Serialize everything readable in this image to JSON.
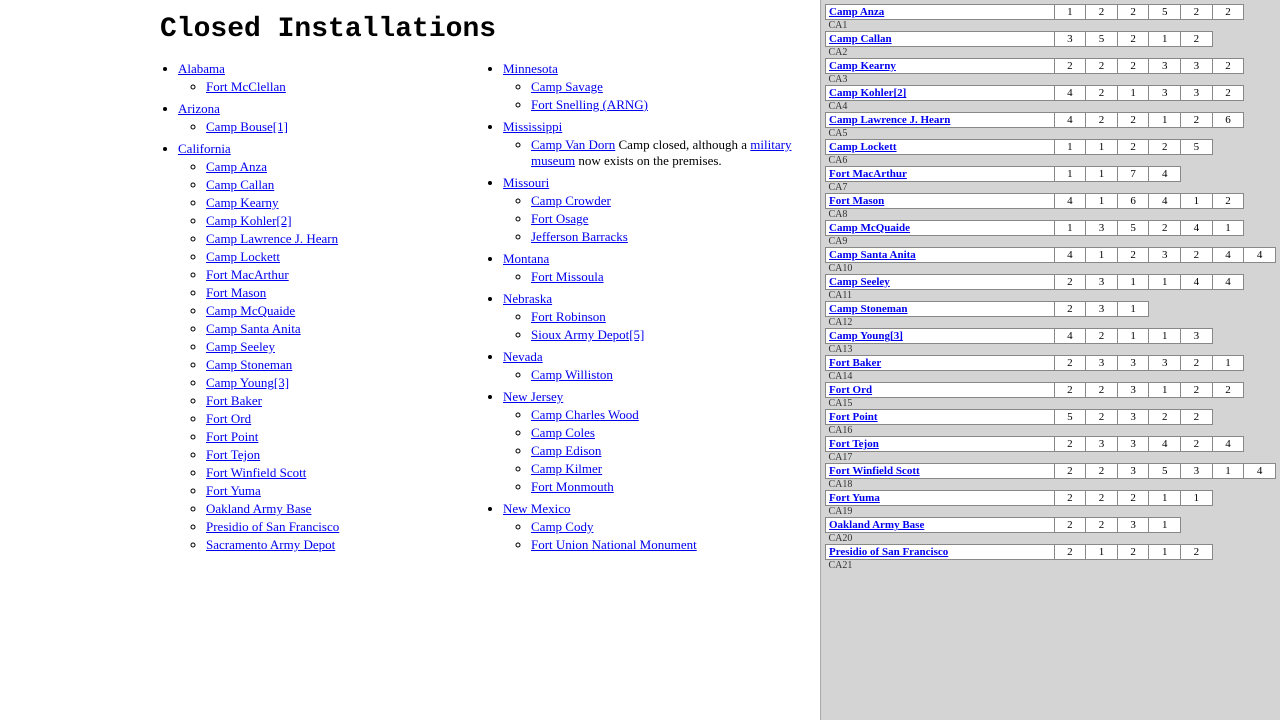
{
  "page": {
    "title": "Closed Installations"
  },
  "left_column": {
    "states": [
      {
        "name": "Alabama",
        "installations": [
          {
            "name": "Fort McClellan",
            "sub": false
          }
        ]
      },
      {
        "name": "Arizona",
        "installations": [
          {
            "name": "Camp Bouse[1]",
            "sub": false
          }
        ]
      },
      {
        "name": "California",
        "installations": [
          {
            "name": "Camp Anza",
            "sub": false
          },
          {
            "name": "Camp Callan",
            "sub": false
          },
          {
            "name": "Camp Kearny",
            "sub": false
          },
          {
            "name": "Camp Kohler[2]",
            "sub": false
          },
          {
            "name": "Camp Lawrence J. Hearn",
            "sub": false
          },
          {
            "name": "Camp Lockett",
            "sub": false
          },
          {
            "name": "Fort MacArthur",
            "sub": false
          },
          {
            "name": "Fort Mason",
            "sub": false
          },
          {
            "name": "Camp McQuaide",
            "sub": false
          },
          {
            "name": "Camp Santa Anita",
            "sub": false
          },
          {
            "name": "Camp Seeley",
            "sub": false
          },
          {
            "name": "Camp Stoneman",
            "sub": false
          },
          {
            "name": "Camp Young[3]",
            "sub": false
          },
          {
            "name": "Fort Baker",
            "sub": false
          },
          {
            "name": "Fort Ord",
            "sub": false
          },
          {
            "name": "Fort Point",
            "sub": false
          },
          {
            "name": "Fort Tejon",
            "sub": false
          },
          {
            "name": "Fort Winfield Scott",
            "sub": false
          },
          {
            "name": "Fort Yuma",
            "sub": false
          },
          {
            "name": "Oakland Army Base",
            "sub": false
          },
          {
            "name": "Presidio of San Francisco",
            "sub": false
          },
          {
            "name": "Sacramento Army Depot",
            "sub": false
          }
        ]
      }
    ]
  },
  "right_column": {
    "states": [
      {
        "name": "Minnesota",
        "installations": [
          {
            "name": "Camp Savage",
            "sub": false
          },
          {
            "name": "Fort Snelling (ARNG)",
            "sub": false
          }
        ]
      },
      {
        "name": "Mississippi",
        "installations": [
          {
            "name": "Camp Van Dorn",
            "note": "Camp closed, although a military museum now exists on the premises.",
            "sub": false
          }
        ]
      },
      {
        "name": "Missouri",
        "installations": [
          {
            "name": "Camp Crowder",
            "sub": false
          },
          {
            "name": "Fort Osage",
            "sub": false
          },
          {
            "name": "Jefferson Barracks",
            "sub": false
          }
        ]
      },
      {
        "name": "Montana",
        "installations": [
          {
            "name": "Fort Missoula",
            "sub": false
          }
        ]
      },
      {
        "name": "Nebraska",
        "installations": [
          {
            "name": "Fort Robinson",
            "sub": false
          },
          {
            "name": "Sioux Army Depot[5]",
            "sub": false
          }
        ]
      },
      {
        "name": "Nevada",
        "installations": [
          {
            "name": "Camp Williston",
            "sub": false
          }
        ]
      },
      {
        "name": "New Jersey",
        "installations": [
          {
            "name": "Camp Charles Wood",
            "sub": false
          },
          {
            "name": "Camp Coles",
            "sub": false
          },
          {
            "name": "Camp Edison",
            "sub": false
          },
          {
            "name": "Camp Kilmer",
            "sub": false
          },
          {
            "name": "Fort Monmouth",
            "sub": false
          }
        ]
      },
      {
        "name": "New Mexico",
        "installations": [
          {
            "name": "Camp Cody",
            "sub": false
          },
          {
            "name": "Fort Union National Monument",
            "sub": false
          }
        ]
      }
    ]
  },
  "table": {
    "rows": [
      {
        "name": "Camp Anza",
        "label": "CA1",
        "nums": [
          "1",
          "2",
          "2",
          "5",
          "2",
          "2"
        ]
      },
      {
        "name": "Camp Callan",
        "label": "CA2",
        "nums": [
          "3",
          "5",
          "2",
          "1",
          "2"
        ]
      },
      {
        "name": "Camp Kearny",
        "label": "CA3",
        "nums": [
          "2",
          "2",
          "2",
          "3",
          "3",
          "2"
        ]
      },
      {
        "name": "Camp Kohler[2]",
        "label": "CA4",
        "nums": [
          "4",
          "2",
          "1",
          "3",
          "3",
          "2"
        ]
      },
      {
        "name": "Camp Lawrence J. Hearn",
        "label": "CA5",
        "nums": [
          "4",
          "2",
          "2",
          "1",
          "2",
          "6"
        ]
      },
      {
        "name": "Camp Lockett",
        "label": "CA6",
        "nums": [
          "1",
          "1",
          "2",
          "2",
          "5"
        ]
      },
      {
        "name": "Fort MacArthur",
        "label": "CA7",
        "nums": [
          "1",
          "1",
          "7",
          "4"
        ]
      },
      {
        "name": "Fort Mason",
        "label": "CA8",
        "nums": [
          "4",
          "1",
          "6",
          "4",
          "1",
          "2"
        ]
      },
      {
        "name": "Camp McQuaide",
        "label": "CA9",
        "nums": [
          "1",
          "3",
          "5",
          "2",
          "4",
          "1"
        ]
      },
      {
        "name": "Camp Santa Anita",
        "label": "CA10",
        "nums": [
          "4",
          "1",
          "2",
          "3",
          "2",
          "4",
          "4"
        ]
      },
      {
        "name": "Camp Seeley",
        "label": "CA11",
        "nums": [
          "2",
          "3",
          "1",
          "1",
          "4",
          "4"
        ]
      },
      {
        "name": "Camp Stoneman",
        "label": "CA12",
        "nums": [
          "2",
          "3",
          "1"
        ]
      },
      {
        "name": "Camp Young[3]",
        "label": "CA13",
        "nums": [
          "4",
          "2",
          "1",
          "1",
          "3"
        ]
      },
      {
        "name": "Fort Baker",
        "label": "CA14",
        "nums": [
          "2",
          "3",
          "3",
          "3",
          "2",
          "1"
        ]
      },
      {
        "name": "Fort Ord",
        "label": "CA15",
        "nums": [
          "2",
          "2",
          "3",
          "1",
          "2",
          "2"
        ]
      },
      {
        "name": "Fort Point",
        "label": "CA16",
        "nums": [
          "5",
          "2",
          "3",
          "2",
          "2"
        ]
      },
      {
        "name": "Fort Tejon",
        "label": "CA17",
        "nums": [
          "2",
          "3",
          "3",
          "4",
          "2",
          "4"
        ]
      },
      {
        "name": "Fort Winfield Scott",
        "label": "CA18",
        "nums": [
          "2",
          "2",
          "3",
          "5",
          "3",
          "1",
          "4"
        ]
      },
      {
        "name": "Fort Yuma",
        "label": "CA19",
        "nums": [
          "2",
          "2",
          "2",
          "1",
          "1"
        ]
      },
      {
        "name": "Oakland Army Base",
        "label": "CA20",
        "nums": [
          "2",
          "2",
          "3",
          "1"
        ]
      },
      {
        "name": "Presidio of San Francisco",
        "label": "CA21",
        "nums": [
          "2",
          "1",
          "2",
          "1",
          "2"
        ]
      }
    ]
  }
}
